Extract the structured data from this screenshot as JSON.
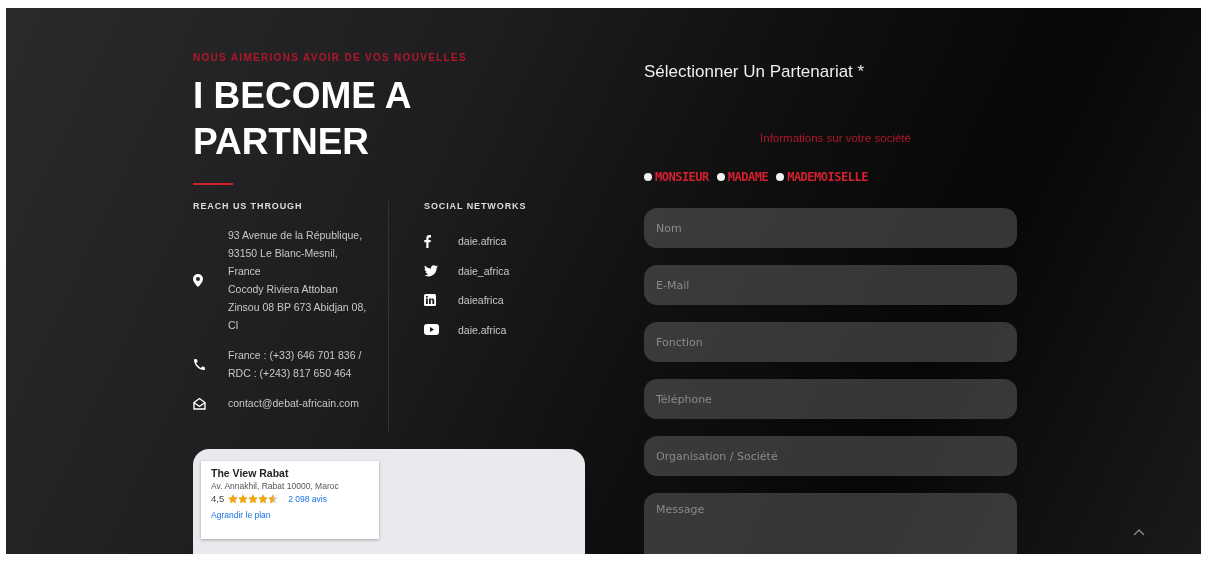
{
  "contact": {
    "kicker": "NOUS AIMERIONS AVOIR DE VOS NOUVELLES",
    "title": "I BECOME A PARTNER",
    "reach_heading": "REACH US THROUGH",
    "social_heading": "SOCIAL NETWORKS",
    "items": [
      {
        "kind": "address",
        "lines": [
          "93 Avenue de la République,",
          "93150 Le Blanc-Mesnil,",
          "France",
          "Cocody Riviera Attoban",
          "Zinsou 08 BP 673 Abidjan 08,",
          "CI"
        ]
      },
      {
        "kind": "phone",
        "lines": [
          "France : (+33) 646 701 836 /",
          "RDC : (+243) 817 650 464"
        ]
      },
      {
        "kind": "email",
        "lines": [
          "contact@debat-africain.com"
        ]
      }
    ],
    "socials": [
      {
        "kind": "facebook",
        "label": "daie.africa"
      },
      {
        "kind": "twitter",
        "label": "daie_africa"
      },
      {
        "kind": "linkedin",
        "label": "daieafrica"
      },
      {
        "kind": "youtube",
        "label": "daie.africa"
      }
    ]
  },
  "map": {
    "place": "The View Rabat",
    "address": "Av. Annakhil, Rabat 10000, Maroc",
    "rating": "4,5",
    "stars": 4.5,
    "reviews": "2 098 avis",
    "enlarge": "Agrandir le plan"
  },
  "form": {
    "title": "Sélectionner Un Partenariat *",
    "section": "Informations sur votre société",
    "civility": [
      {
        "label": "MONSIEUR",
        "selected": false
      },
      {
        "label": "MADAME",
        "selected": false
      },
      {
        "label": "MADEMOISELLE",
        "selected": false
      }
    ],
    "fields": [
      {
        "kind": "text",
        "placeholder": "Nom"
      },
      {
        "kind": "text",
        "placeholder": "E-Mail"
      },
      {
        "kind": "text",
        "placeholder": "Fonction"
      },
      {
        "kind": "text",
        "placeholder": "Téléphone"
      },
      {
        "kind": "text",
        "placeholder": "Organisation / Société"
      },
      {
        "kind": "textarea",
        "placeholder": "Message"
      }
    ]
  }
}
